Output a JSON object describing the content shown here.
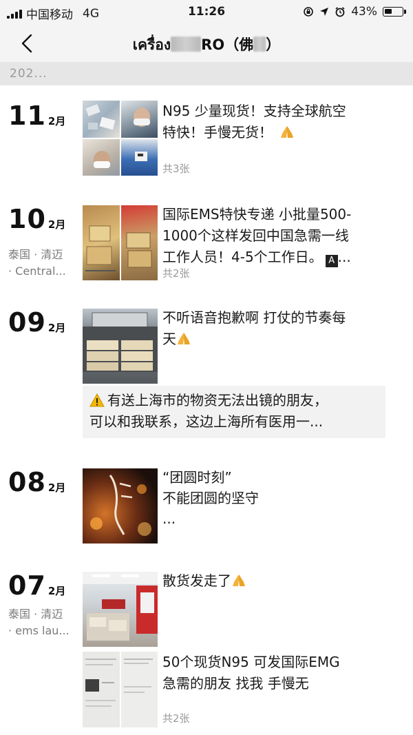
{
  "status_bar": {
    "carrier": "中国移动",
    "network": "4G",
    "time": "11:26",
    "battery": "43%",
    "battery_level": 0.43,
    "icons": [
      "signal-icon",
      "lock-rotation-icon",
      "location-arrow-icon",
      "alarm-icon",
      "battery-icon"
    ]
  },
  "nav": {
    "title_start": "เครื่อง",
    "title_mid": "RO（佛",
    "title_end": "）"
  },
  "year_label": "202...",
  "accent_colors": {
    "background": "#ffffff",
    "bar": "#f4f4f4",
    "share_box": "#f2f2f2",
    "muted_text": "#999999"
  },
  "posts": [
    {
      "day": "11",
      "month": "2月",
      "text_lines": [
        "N95 少量现货！支持全球航空",
        "特快！手慢无货！"
      ],
      "count": "共3张"
    },
    {
      "day": "10",
      "month": "2月",
      "location": [
        "泰国 · 清迈",
        "· Central..."
      ],
      "text_lines": [
        "国际EMS特快专递 小批量500-",
        "1000个这样发回中国急需一线",
        "工作人员！4-5个工作日。"
      ],
      "count": "共2张"
    },
    {
      "day": "09",
      "month": "2月",
      "text_lines": [
        "不听语音抱歉啊 打仗的节奏每",
        "天"
      ],
      "share_lines": [
        "有送上海市的物资无法出镜的朋友，",
        "可以和我联系，这边上海所有医用一..."
      ]
    },
    {
      "day": "08",
      "month": "2月",
      "text_lines": [
        "“团圆时刻”",
        "不能团圆的坚守",
        "..."
      ]
    },
    {
      "day": "07",
      "month": "2月",
      "location": [
        "泰国 · 清迈",
        "· ems lau..."
      ],
      "text_lines": [
        "散货发走了"
      ],
      "text2_lines": [
        "50个现货N95 可发国际EMG",
        "急需的朋友 找我 手慢无"
      ],
      "count": "共2张"
    }
  ]
}
